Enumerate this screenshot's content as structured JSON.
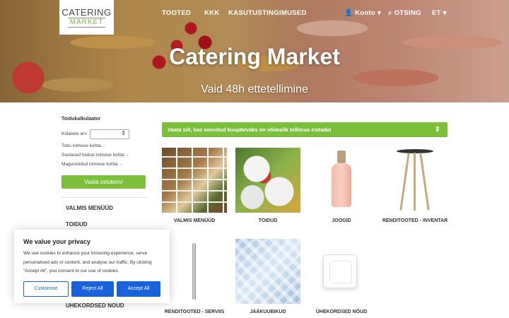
{
  "logo": {
    "line1": "CATERING",
    "line2": "MARKET"
  },
  "nav": {
    "items": [
      "TOOTED",
      "KKK",
      "KASUTUSTINGIMUSED"
    ],
    "account": "Konto",
    "search": "OTSING",
    "lang": "ET"
  },
  "hero": {
    "title": "Catering Market",
    "subtitle": "Vaid 48h ettetellimine"
  },
  "sidebar": {
    "title": "Toidukalkulaator",
    "guests_label": "Külaliste arv:",
    "food_per_person": "Toitu inimese kohta: -",
    "salty_per_person": "Soolased toidud inimese kohta: -",
    "dessert_per_person": "Magustoidud inimese kohta: -",
    "cart_button": "Vaata ostukorvi",
    "categories": [
      "VALMIS MENÜÜD",
      "TOIDUD",
      "ÜHEKORDSED NÕUD"
    ]
  },
  "banner": {
    "text": "Vaata siit, kas soovitud kuupäevaks on võimalik tellimus esitada!",
    "icon": "expand-icon"
  },
  "products": [
    {
      "label": "VALMIS MENÜÜD"
    },
    {
      "label": "TOIDUD"
    },
    {
      "label": "JOOGID"
    },
    {
      "label": "RENDITOOTED - INVENTAR"
    },
    {
      "label": "RENDITOOTED - SERVIIS"
    },
    {
      "label": "JÄÄKUUBIKUD"
    },
    {
      "label": "ÜHEKORDSED NÕUD"
    }
  ],
  "cookie": {
    "title": "We value your privacy",
    "text": "We use cookies to enhance your browsing experience, serve personalised ads or content, and analyse our traffic. By clicking \"Accept All\", you consent to our use of cookies.",
    "customise": "Customise",
    "reject": "Reject All",
    "accept": "Accept All"
  },
  "colors": {
    "accent": "#7cbf3a",
    "cookie_button": "#1863dc"
  }
}
